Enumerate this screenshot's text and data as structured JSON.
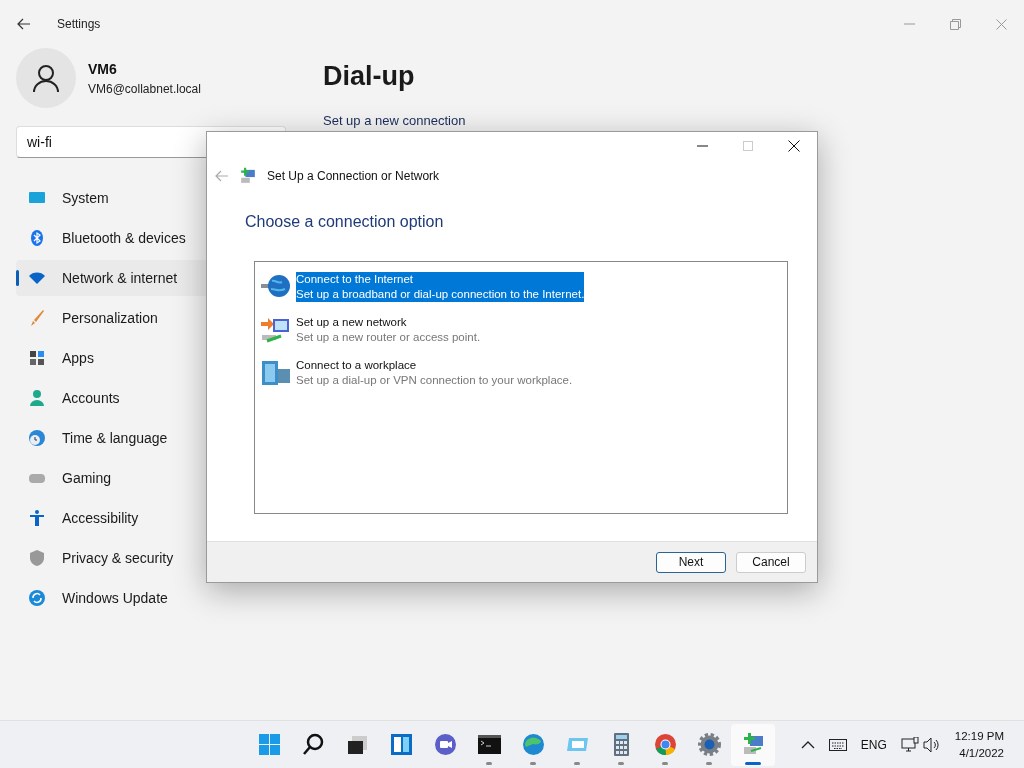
{
  "settings": {
    "title": "Settings",
    "user": {
      "name": "VM6",
      "email": "VM6@collabnet.local"
    },
    "search": {
      "value": "wi-fi"
    },
    "nav": [
      {
        "label": "System",
        "selected": false
      },
      {
        "label": "Bluetooth & devices",
        "selected": false
      },
      {
        "label": "Network & internet",
        "selected": true
      },
      {
        "label": "Personalization",
        "selected": false
      },
      {
        "label": "Apps",
        "selected": false
      },
      {
        "label": "Accounts",
        "selected": false
      },
      {
        "label": "Time & language",
        "selected": false
      },
      {
        "label": "Gaming",
        "selected": false
      },
      {
        "label": "Accessibility",
        "selected": false
      },
      {
        "label": "Privacy & security",
        "selected": false
      },
      {
        "label": "Windows Update",
        "selected": false
      }
    ],
    "page_title": "Dial-up",
    "link": "Set up a new connection"
  },
  "dialog": {
    "title": "Set Up a Connection or Network",
    "heading": "Choose a connection option",
    "options": [
      {
        "title": "Connect to the Internet",
        "description": "Set up a broadband or dial-up connection to the Internet.",
        "selected": true
      },
      {
        "title": "Set up a new network",
        "description": "Set up a new router or access point.",
        "selected": false
      },
      {
        "title": "Connect to a workplace",
        "description": "Set up a dial-up or VPN connection to your workplace.",
        "selected": false
      }
    ],
    "buttons": [
      "Next",
      "Cancel"
    ]
  },
  "taskbar": {
    "apps": [
      {
        "running": false,
        "selected": false
      },
      {
        "running": false,
        "selected": false
      },
      {
        "running": false,
        "selected": false
      },
      {
        "running": false,
        "selected": false
      },
      {
        "running": false,
        "selected": false
      },
      {
        "running": true,
        "selected": false
      },
      {
        "running": true,
        "selected": false
      },
      {
        "running": true,
        "selected": false
      },
      {
        "running": true,
        "selected": false
      },
      {
        "running": true,
        "selected": false
      },
      {
        "running": true,
        "selected": false
      },
      {
        "running": true,
        "selected": true
      }
    ],
    "language": "ENG",
    "time": "12:19 PM",
    "date": "4/1/2022"
  }
}
